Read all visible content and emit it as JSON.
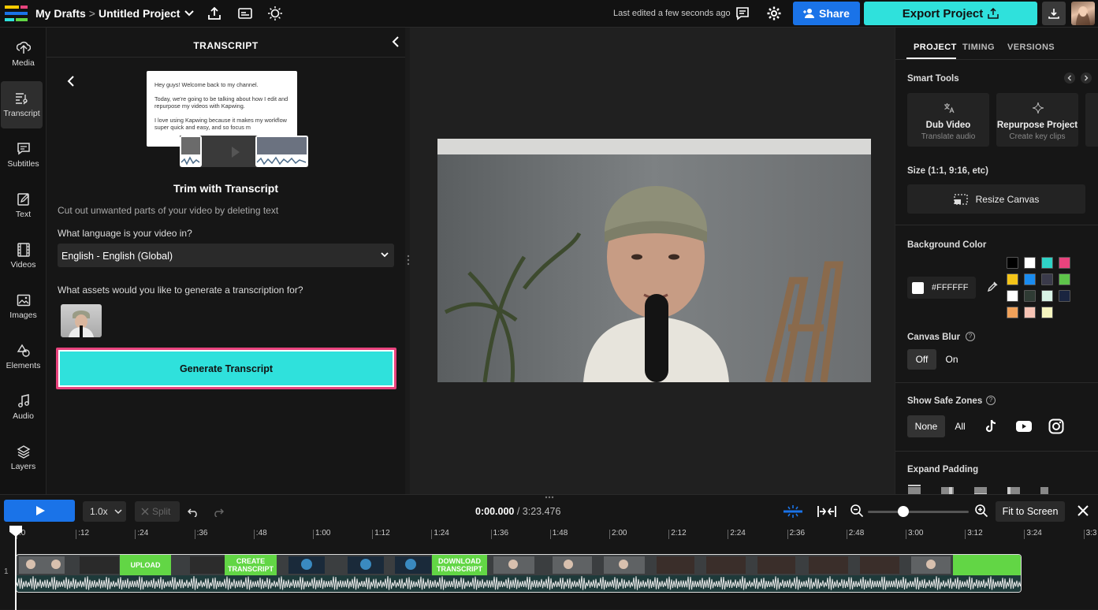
{
  "topbar": {
    "breadcrumb_parent": "My Drafts",
    "breadcrumb_sep": ">",
    "project_name": "Untitled Project",
    "last_edited": "Last edited a few seconds ago",
    "share_label": "Share",
    "export_label": "Export Project"
  },
  "rail": {
    "items": [
      {
        "label": "Media",
        "icon": "upload-icon"
      },
      {
        "label": "Transcript",
        "icon": "transcript-icon"
      },
      {
        "label": "Subtitles",
        "icon": "subtitles-icon"
      },
      {
        "label": "Text",
        "icon": "text-icon"
      },
      {
        "label": "Videos",
        "icon": "film-icon"
      },
      {
        "label": "Images",
        "icon": "image-icon"
      },
      {
        "label": "Elements",
        "icon": "shapes-icon"
      },
      {
        "label": "Audio",
        "icon": "music-icon"
      },
      {
        "label": "Layers",
        "icon": "layers-icon"
      }
    ]
  },
  "transcript": {
    "title": "TRANSCRIPT",
    "doc_lines": [
      "Hey guys! Welcome back to my channel.",
      "Today, we're going to be talking about how I edit and repurpose my videos with Kapwing.",
      "I love using Kapwing because it makes my workflow super quick and easy, and so focus m"
    ],
    "heading": "Trim with Transcript",
    "description": "Cut out unwanted parts of your video by deleting text",
    "language_label": "What language is your video in?",
    "language_value": "English - English (Global)",
    "assets_label": "What assets would you like to generate a transcription for?",
    "generate_label": "Generate Transcript"
  },
  "right": {
    "tabs": [
      "PROJECT",
      "TIMING",
      "VERSIONS"
    ],
    "smart_tools_label": "Smart Tools",
    "tools": [
      {
        "title": "Dub Video",
        "sub": "Translate audio"
      },
      {
        "title": "Repurpose Project",
        "sub": "Create key clips"
      }
    ],
    "size_label": "Size (1:1, 9:16, etc)",
    "resize_label": "Resize Canvas",
    "bg_label": "Background Color",
    "bg_value": "#FFFFFF",
    "palette": [
      "#000000",
      "#ffffff",
      "#2fd3c6",
      "#e8437d",
      "#f5c518",
      "#1a8cf0",
      "#3a3a4a",
      "#5ec44a",
      "#ffffff",
      "#2f3b34",
      "#d8f3e6",
      "#1a2540",
      "#f0a15a",
      "#f6c3b4",
      "#f6f6c0"
    ],
    "blur_label": "Canvas Blur",
    "blur_off": "Off",
    "blur_on": "On",
    "safe_label": "Show Safe Zones",
    "safe_none": "None",
    "safe_all": "All",
    "padding_label": "Expand Padding"
  },
  "timeline": {
    "speed": "1.0x",
    "split": "Split",
    "current_time": "0:00.000",
    "total_time": "/ 3:23.476",
    "fit_label": "Fit to Screen",
    "track_number": "1",
    "ticks": [
      ":0",
      ":12",
      ":24",
      ":36",
      ":48",
      "1:00",
      "1:12",
      "1:24",
      "1:36",
      "1:48",
      "2:00",
      "2:12",
      "2:24",
      "2:36",
      "2:48",
      "3:00",
      "3:12",
      "3:24",
      "3:3"
    ],
    "clip_labels": [
      "UPLOAD",
      "CREATE TRANSCRIPT",
      "DOWNLOAD TRANSCRIPT"
    ]
  }
}
